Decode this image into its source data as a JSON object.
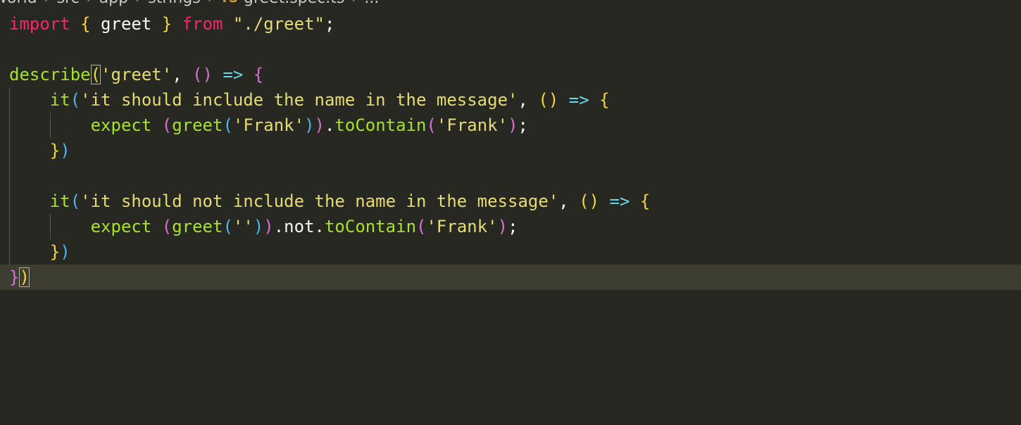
{
  "breadcrumb": {
    "items": [
      "world",
      "src",
      "app",
      "strings"
    ],
    "file_icon": "TS",
    "file": "greet.spec.ts",
    "more": "..."
  },
  "code": {
    "line1": {
      "import": "import",
      "open": "{",
      "name": " greet ",
      "close": "}",
      "from": "from",
      "path": "\"./greet\"",
      "semi": ";"
    },
    "line3": {
      "describe": "describe",
      "open": "(",
      "title": "'greet'",
      "comma": ", ",
      "parens": "()",
      "arrow": "=>",
      "brace": "{"
    },
    "line4": {
      "it": "it",
      "open": "(",
      "title": "'it should include the name in the message'",
      "comma": ", ",
      "parens": "()",
      "arrow": "=>",
      "brace": "{"
    },
    "line5": {
      "expect": "expect",
      "open": "(",
      "greet": "greet",
      "gopen": "(",
      "arg": "'Frank'",
      "gclose": ")",
      "close": ")",
      "dot": ".",
      "method": "toContain",
      "mopen": "(",
      "marg": "'Frank'",
      "mclose": ")",
      "semi": ";"
    },
    "line6": {
      "brace": "}",
      "paren": ")"
    },
    "line8": {
      "it": "it",
      "open": "(",
      "title": "'it should not include the name in the message'",
      "comma": ", ",
      "parens": "()",
      "arrow": "=>",
      "brace": "{"
    },
    "line9": {
      "expect": "expect",
      "open": "(",
      "greet": "greet",
      "gopen": "(",
      "arg": "''",
      "gclose": ")",
      "close": ")",
      "dot1": ".",
      "not": "not",
      "dot2": ".",
      "method": "toContain",
      "mopen": "(",
      "marg": "'Frank'",
      "mclose": ")",
      "semi": ";"
    },
    "line10": {
      "brace": "}",
      "paren": ")"
    },
    "line11": {
      "brace": "}",
      "paren": ")"
    }
  },
  "colors": {
    "background": "#272822",
    "current_line": "#3e3d32",
    "keyword": "#f92672",
    "function": "#a6e22e",
    "string": "#e6db74",
    "bracket_yellow": "#f7d53c",
    "bracket_purple": "#da70d6",
    "bracket_blue": "#4fb6f0"
  }
}
